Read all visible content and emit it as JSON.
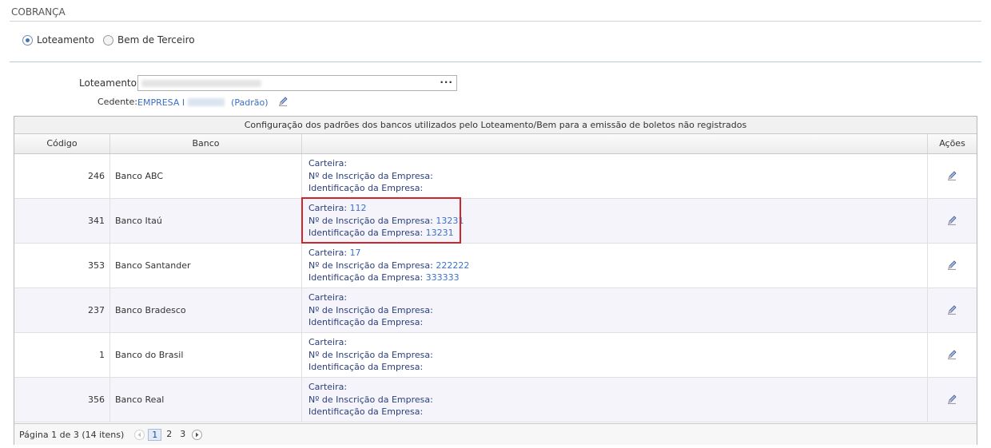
{
  "section": {
    "title": "COBRANÇA"
  },
  "radios": [
    {
      "label": "Loteamento",
      "checked": true
    },
    {
      "label": "Bem de Terceiro",
      "checked": false
    }
  ],
  "form": {
    "loteamento_label": "Loteamento",
    "lookup_button": "···",
    "cedente_label": "Cedente:",
    "cedente_prefix": "EMPRESA I",
    "cedente_suffix": "(Padrão)"
  },
  "grid": {
    "caption": "Configuração dos padrões dos bancos utilizados pelo Loteamento/Bem para a emissão de boletos não registrados",
    "headers": {
      "code": "Código",
      "bank": "Banco",
      "info": "",
      "actions": "Ações"
    },
    "field_labels": {
      "carteira": "Carteira:",
      "inscricao": "Nº de Inscrição da Empresa:",
      "identificacao": "Identificação da Empresa:"
    },
    "rows": [
      {
        "code": "246",
        "bank": "Banco ABC",
        "carteira": "",
        "inscricao": "",
        "identificacao": ""
      },
      {
        "code": "341",
        "bank": "Banco Itaú",
        "carteira": "112",
        "inscricao": "13231",
        "identificacao": "13231"
      },
      {
        "code": "353",
        "bank": "Banco Santander",
        "carteira": "17",
        "inscricao": "222222",
        "identificacao": "333333"
      },
      {
        "code": "237",
        "bank": "Banco Bradesco",
        "carteira": "",
        "inscricao": "",
        "identificacao": ""
      },
      {
        "code": "1",
        "bank": "Banco do Brasil",
        "carteira": "",
        "inscricao": "",
        "identificacao": ""
      },
      {
        "code": "356",
        "bank": "Banco Real",
        "carteira": "",
        "inscricao": "",
        "identificacao": ""
      }
    ]
  },
  "pager": {
    "summary": "Página 1 de 3 (14 itens)",
    "pages": [
      "1",
      "2",
      "3"
    ],
    "current": "1"
  },
  "colors": {
    "link": "#3c72c9",
    "highlight": "#d0252b",
    "alt_row": "#f5f4fa"
  }
}
